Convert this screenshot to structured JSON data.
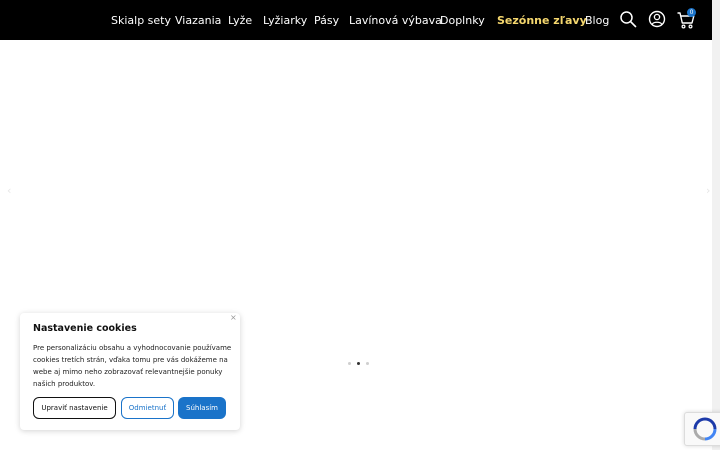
{
  "nav": {
    "items": [
      "Skialp sety",
      "Viazania",
      "Lyže",
      "Lyžiarky",
      "Pásy",
      "Lavínová výbava",
      "Doplnky"
    ],
    "sale": "Sezónne zľavy",
    "blog": "Blog",
    "cart_count": "0",
    "icons": [
      "search-icon",
      "account-icon",
      "cart-icon"
    ],
    "sale_color": "#f5d76e"
  },
  "slider": {
    "prev_arrow": "‹",
    "next_arrow": "›",
    "slide_count": 3,
    "active_slide": 2
  },
  "cookie": {
    "title": "Nastavenie cookies",
    "text": "Pre personalizáciu obsahu a vyhodnocovanie používame cookies tretích strán, vďaka tomu pre vás dokážeme na webe aj mimo neho zobrazovať relevantnejšie ponuky našich produktov.",
    "close": "×",
    "btn_settings": "Upraviť nastavenie",
    "btn_reject": "Odmietnuť",
    "btn_accept": "Súhlasím",
    "accent_color": "#1a73c9"
  }
}
